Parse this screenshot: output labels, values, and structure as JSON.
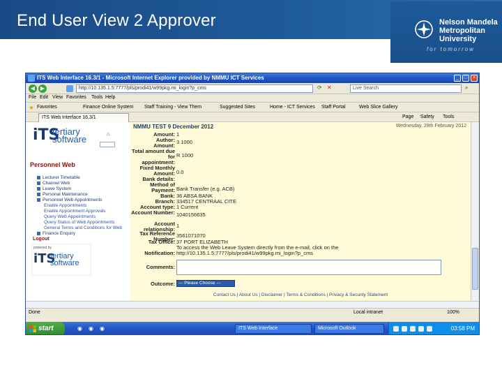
{
  "slide": {
    "title": "End User View 2 Approver",
    "logo": {
      "line1": "Nelson Mandela",
      "line2": "Metropolitan",
      "line3": "University",
      "tagline": "for tomorrow"
    }
  },
  "browser": {
    "window_title": "ITS Web Interface 16.3/1 - Microsoft Internet Explorer provided by NMMU ICT Services",
    "address_url": "http://10.135.1.5:7777/pls/prodi41/w99pkg.mi_login?p_cms",
    "search_placeholder": "Live Search",
    "menu": [
      "File",
      "Edit",
      "View",
      "Favorites",
      "Tools",
      "Help"
    ],
    "favorites": [
      {
        "label": "Favorites"
      },
      {
        "label": "Finance Online System"
      },
      {
        "label": "Staff Training - View Them"
      },
      {
        "label": "Suggested Sites"
      },
      {
        "label": "Home - ICT Services"
      },
      {
        "label": "Staff Portal"
      },
      {
        "label": "Web Slice Gallery"
      }
    ],
    "tab_label": "ITS Web Interface 16.3/1",
    "toolbar": [
      "Page",
      "Safety",
      "Tools"
    ],
    "status_left": "Done",
    "status_zone": "Local intranet",
    "zoom": "100%"
  },
  "its": {
    "letters": "iTS",
    "word1": "tertiary",
    "word2": "software",
    "powered": "powered by"
  },
  "sidebar": {
    "heading": "Personnel Web",
    "items": [
      {
        "label": "Lecturer Timetable"
      },
      {
        "label": "Channel Web"
      },
      {
        "label": "Leave System"
      },
      {
        "label": "Personal Maintenance"
      },
      {
        "label": "Personnel Web Appointments"
      }
    ],
    "sub_items": [
      {
        "label": "Enable Appointments"
      },
      {
        "label": "Enable Appointment Approvals"
      },
      {
        "label": "Query Web Appointments"
      },
      {
        "label": "Query Status of Web Appointments"
      },
      {
        "label": "General Terms and Conditions for Web"
      },
      {
        "label": "Finance Enquiry"
      }
    ],
    "logout": "Logout"
  },
  "page": {
    "header": "NMMU TEST 9 December 2012",
    "date": "Wednesday, 29th February 2012",
    "fields": [
      {
        "label": "Amount:",
        "value": "1"
      },
      {
        "label": "Author:",
        "value": "3 1000"
      },
      {
        "label": "Amount:",
        "value": ""
      },
      {
        "label": "Total amount due for",
        "value": "R 1000"
      },
      {
        "label": "appointment:",
        "value": ""
      },
      {
        "label": "Fixed Monthly Amount:",
        "value": "0.0"
      },
      {
        "label": "Bank details:",
        "value": ""
      },
      {
        "label": "Method of Payment:",
        "value": "Bank Transfer (e.g. ACB)"
      },
      {
        "label": "Bank:",
        "value": "36 ABSA BANK"
      },
      {
        "label": "Branch:",
        "value": "334517 CENTRAAL CITE"
      },
      {
        "label": "Account type:",
        "value": "1 Current"
      },
      {
        "label": "Account Number:",
        "value": "1040156635"
      },
      {
        "label": "Account relationship:",
        "value": "1"
      },
      {
        "label": "Tax Reference Number:",
        "value": "3561071070"
      },
      {
        "label": "Tax Office:",
        "value": "37 PORT ELIZABETH"
      },
      {
        "label": "",
        "value": "To access the Web Leave System directly from the e-mail, click on the"
      },
      {
        "label": "Notification:",
        "value": "http://10.135.1.5:7777/pls/prodi41/w99pkg.mi_login?p_cms"
      }
    ],
    "comments_label": "Comments:",
    "outcome_label": "Outcome:",
    "outcome_value": "--- Please Choose ---",
    "footer": "Contact Us  |  About Us  |  Disclaimer  |  Terms & Conditions  |  Privacy & Security Statement"
  },
  "taskbar": {
    "start": "start",
    "items": [
      {
        "label": "ITS Web Interface"
      },
      {
        "label": "Microsoft Outlook"
      }
    ],
    "clock": "03:58 PM"
  }
}
